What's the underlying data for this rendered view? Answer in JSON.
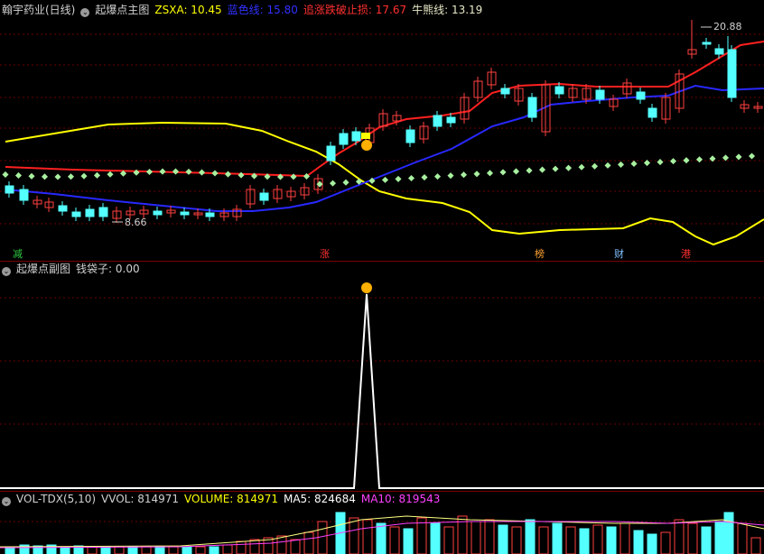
{
  "main_header": {
    "stock": "翰宇药业(日线)",
    "indicator": "起爆点主图",
    "zsxa_label": "ZSXA: 10.45",
    "blue_label": "蓝色线: 15.80",
    "red_label": "追涨跌破止损: 17.67",
    "bull_label": "牛熊线: 13.19",
    "colors": {
      "zsxa": "#ffff00",
      "blue": "#3030ff",
      "red": "#ff3030",
      "bull": "#e8e8c8"
    }
  },
  "main_annotations": {
    "high": "20.88",
    "low": "8.66",
    "markers": [
      "减",
      "涨",
      "榜",
      "财",
      "港"
    ]
  },
  "sub_header": {
    "indicator": "起爆点副图",
    "value_label": "钱袋子: 0.00"
  },
  "vol_header": {
    "name": "VOL-TDX(5,10)",
    "vvol": "VVOL: 814971",
    "volume": "VOLUME: 814971",
    "ma5": "MA5: 824684",
    "ma10": "MA10: 819543",
    "colors": {
      "volume": "#ffff00",
      "ma5": "#ffffff",
      "ma10": "#ff40ff"
    }
  },
  "icons": [
    "collapse-circle-icon",
    "money-bag-icon"
  ]
}
